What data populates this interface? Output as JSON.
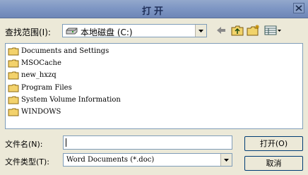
{
  "window": {
    "title": "打开",
    "close_icon": "close-icon"
  },
  "look_in": {
    "label": "查找范围(I):",
    "value": "本地磁盘 (C:)",
    "icon": "drive-icon"
  },
  "toolbar": {
    "icons": [
      "back-arrow-icon",
      "up-folder-icon",
      "new-folder-icon",
      "view-menu-icon"
    ]
  },
  "file_list": {
    "items": [
      {
        "name": "Documents and Settings",
        "icon": "folder-icon"
      },
      {
        "name": "MSOCache",
        "icon": "folder-icon"
      },
      {
        "name": "new_hxzq",
        "icon": "folder-icon"
      },
      {
        "name": "Program Files",
        "icon": "folder-icon"
      },
      {
        "name": "System Volume Information",
        "icon": "folder-icon"
      },
      {
        "name": "WINDOWS",
        "icon": "folder-icon"
      }
    ]
  },
  "file_name": {
    "label": "文件名(N):",
    "value": ""
  },
  "file_type": {
    "label": "文件类型(T):",
    "value": "Word Documents (*.doc)"
  },
  "buttons": {
    "open": "打开(O)",
    "cancel": "取消"
  }
}
